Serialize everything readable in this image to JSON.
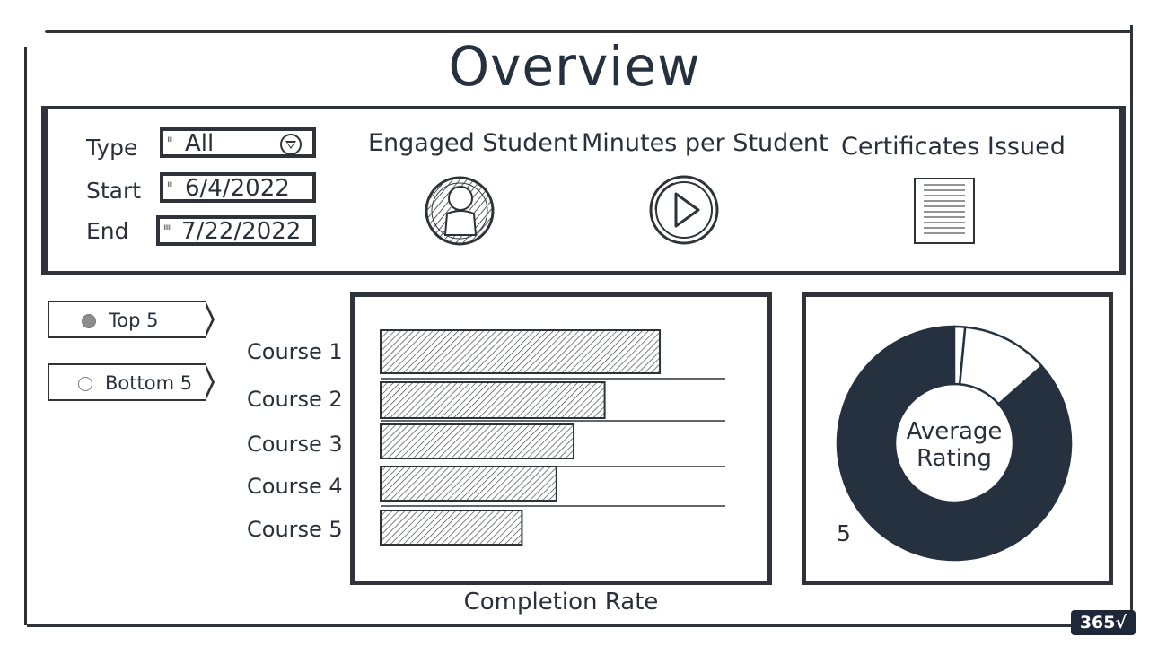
{
  "page": {
    "title": "Overview"
  },
  "filters": {
    "type": {
      "label": "Type",
      "value": "All",
      "icon": "dropdown-triangle-icon"
    },
    "start": {
      "label": "Start",
      "value": "6/4/2022"
    },
    "end": {
      "label": "End",
      "value": "7/22/2022"
    }
  },
  "kpis": [
    {
      "label": "Engaged Student",
      "icon": "user-icon"
    },
    {
      "label": "Minutes per Student",
      "icon": "play-icon"
    },
    {
      "label": "Certificates Issued",
      "icon": "certificate-document-icon"
    }
  ],
  "toggle": {
    "options": [
      {
        "label": "Top 5",
        "selected": true
      },
      {
        "label": "Bottom 5",
        "selected": false
      }
    ]
  },
  "chart_data": [
    {
      "type": "bar",
      "orientation": "horizontal",
      "title": "",
      "xlabel": "Completion Rate",
      "ylabel": "",
      "categories": [
        "Course 1",
        "Course 2",
        "Course 3",
        "Course 4",
        "Course 5"
      ],
      "values": [
        81,
        65,
        56,
        51,
        41
      ],
      "xlim": [
        0,
        100
      ],
      "grid": false
    },
    {
      "type": "pie",
      "style": "donut",
      "center_label": "Average Rating",
      "labels": [
        "5",
        "",
        ""
      ],
      "values": [
        86.5,
        1.5,
        12
      ],
      "colors": [
        "#263140",
        "#ffffff",
        "#ffffff"
      ],
      "visible_label": "5"
    }
  ],
  "branding": {
    "logo_text": "365√"
  }
}
